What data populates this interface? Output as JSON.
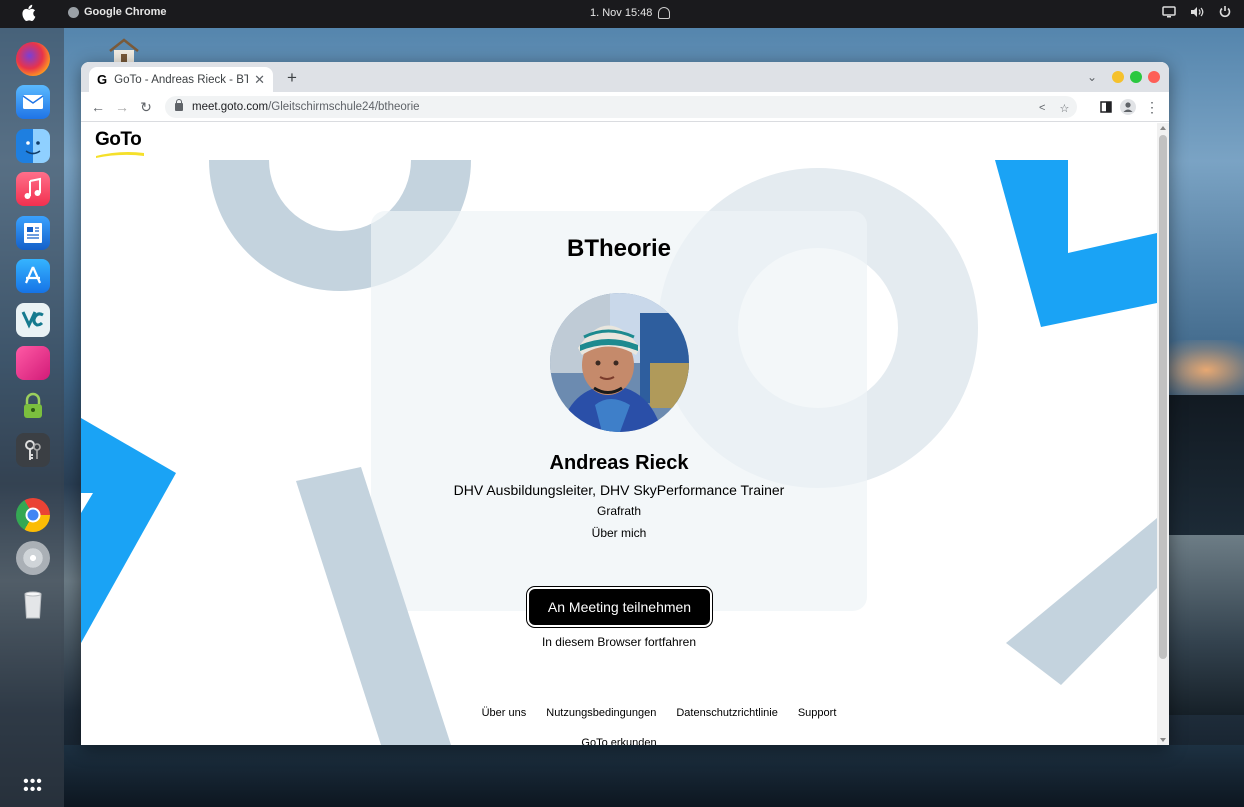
{
  "topbar": {
    "app_name": "Google Chrome",
    "datetime": "1. Nov  15:48"
  },
  "dock": {
    "items": [
      "firefox",
      "mail",
      "finder",
      "music",
      "text-editor",
      "app-store",
      "veracrypt",
      "pink-app",
      "lock-app",
      "keychain",
      "chrome",
      "dvd",
      "trash"
    ]
  },
  "browser": {
    "tab_title": "GoTo - Andreas Rieck - BTh",
    "tab_icon_letter": "G",
    "new_tab_label": "+",
    "url_host": "meet.goto.com",
    "url_path": "/Gleitschirmschule24/btheorie"
  },
  "page": {
    "logo_text": "GoTo",
    "meeting_title": "BTheorie",
    "organizer_name": "Andreas Rieck",
    "organizer_role": "DHV Ausbildungsleiter, DHV SkyPerformance Trainer",
    "organizer_location": "Grafrath",
    "about_link": "Über mich",
    "join_button": "An Meeting teilnehmen",
    "browser_link": "In diesem Browser fortfahren",
    "footer_links": [
      "Über uns",
      "Nutzungsbedingungen",
      "Datenschutzrichtlinie",
      "Support"
    ],
    "footer_explore": "GoTo erkunden"
  },
  "colors": {
    "accent_blue": "#1aa3f5",
    "decor_gray": "#d6e0e7",
    "logo_yellow": "#f5e02a"
  }
}
